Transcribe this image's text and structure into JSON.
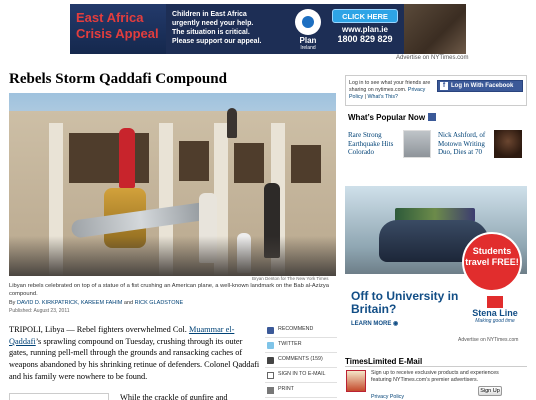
{
  "top_ad": {
    "title_line1": "East Africa",
    "title_line2": "Crisis Appeal",
    "body_line1": "Children in East Africa",
    "body_line2": "urgently need your help.",
    "body_line3": "The situation is critical.",
    "body_line4": "Please support our appeal.",
    "org_name": "Plan",
    "org_sub": "Ireland",
    "cta_label": "CLICK HERE",
    "url": "www.plan.ie",
    "phone": "1800 829 829",
    "credit": "Advertise on NYTimes.com"
  },
  "article": {
    "headline": "Rebels Storm Qaddafi Compound",
    "photo_credit": "Bryan Denton for The New York Times",
    "caption": "Libyan rebels celebrated on top of a statue of a fist crushing an American plane, a well-known landmark on the Bab al-Azizya compound.",
    "byline_prefix": "By",
    "authors": "DAVID D. KIRKPATRICK, KAREEM FAHIM",
    "byline_and": "and",
    "author_last": "RICK GLADSTONE",
    "published": "Published: August 23, 2011",
    "p1_a": "TRIPOLI, Libya — Rebel fighters overwhelmed Col.",
    "p1_link": "Muammar el-Qaddafi",
    "p1_b": "’s sprawling compound on Tuesday, crushing through its outer gates, running pell-mell through the grounds and ransacking caches of weapons abandoned by his shrinking retinue of defenders. Colonel Qaddafi and his family were nowhere to be found.",
    "p2_start": "While the crackle of gunfire and"
  },
  "share": {
    "items": [
      {
        "label": "RECOMMEND",
        "icon": "facebook-icon"
      },
      {
        "label": "TWITTER",
        "icon": "twitter-icon"
      },
      {
        "label": "COMMENTS (159)",
        "icon": "comment-icon"
      },
      {
        "label": "SIGN IN TO E-MAIL",
        "icon": "email-icon"
      },
      {
        "label": "PRINT",
        "icon": "print-icon"
      }
    ]
  },
  "facebook": {
    "text_a": "Log in to see what your friends are sharing on nytimes.com.",
    "privacy": "Privacy Policy",
    "sep": "|",
    "whats_this": "What’s This?",
    "button": "Log In With Facebook"
  },
  "popular": {
    "heading": "What’s Popular Now",
    "item1": "Rare Strong Earthquake Hits Colorado",
    "item2": "Nick Ashford, of Motown Writing Duo, Dies at 70"
  },
  "right_ad": {
    "badge": "Students travel FREE!",
    "headline": "Off to University in Britain?",
    "learn_more": "LEARN MORE ◉",
    "brand": "Stena Line",
    "tagline": "Making good time",
    "credit": "Advertise on NYTimes.com"
  },
  "times_limited": {
    "heading": "TimesLimited E-Mail",
    "text": "Sign up to receive exclusive products and experiences featuring NYTimes.com’s premier advertisers.",
    "button": "Sign Up",
    "privacy": "Privacy Policy"
  }
}
